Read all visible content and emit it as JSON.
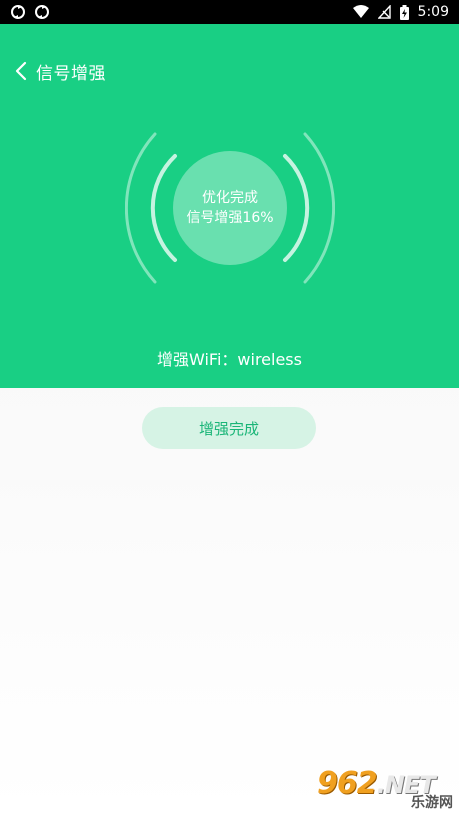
{
  "status_bar": {
    "time": "5:09",
    "left_icons": [
      "sync-icon",
      "sync-icon"
    ],
    "right_icons": [
      "wifi-icon",
      "no-signal-icon",
      "battery-icon"
    ]
  },
  "header": {
    "title": "信号增强",
    "back_icon": "chevron-left-icon",
    "background_color": "#19cf84"
  },
  "result": {
    "line1": "优化完成",
    "line2": "信号增强16%",
    "boost_percent": 16
  },
  "wifi": {
    "label": "增强WiFi：wireless"
  },
  "button": {
    "label": "增强完成"
  },
  "watermark": {
    "brand": "962",
    "suffix": ".NET",
    "site": "乐游网"
  }
}
